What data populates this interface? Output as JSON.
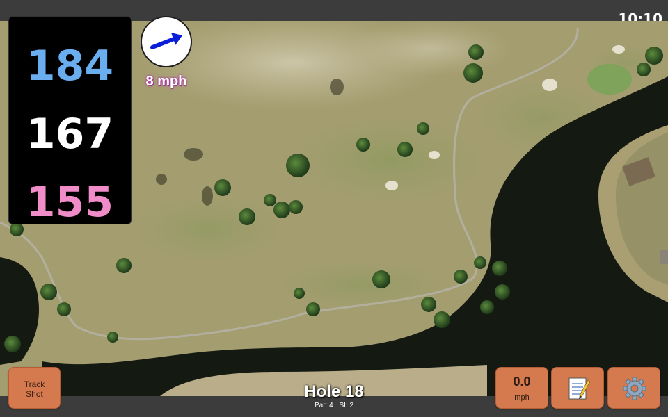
{
  "status_bar": {
    "time": "10:10"
  },
  "distances": {
    "back": "184",
    "center": "167",
    "front": "155",
    "back_color": "#6aaef0",
    "center_color": "#ffffff",
    "front_color": "#f08cc8"
  },
  "wind": {
    "speed_label": "8 mph",
    "arrow_color": "#0a1ed8",
    "direction_icon": "arrow-right-icon"
  },
  "hole": {
    "title": "Hole 18",
    "par_label": "Par: 4",
    "si_label": "SI: 2"
  },
  "buttons": {
    "track_shot": "Track\nShot",
    "wind_value": "0.0",
    "wind_unit": "mph",
    "notes_icon": "notepad-icon",
    "settings_icon": "gear-icon",
    "accent_color": "#d57a4f"
  },
  "map": {
    "imagery": "satellite-golf-course"
  }
}
